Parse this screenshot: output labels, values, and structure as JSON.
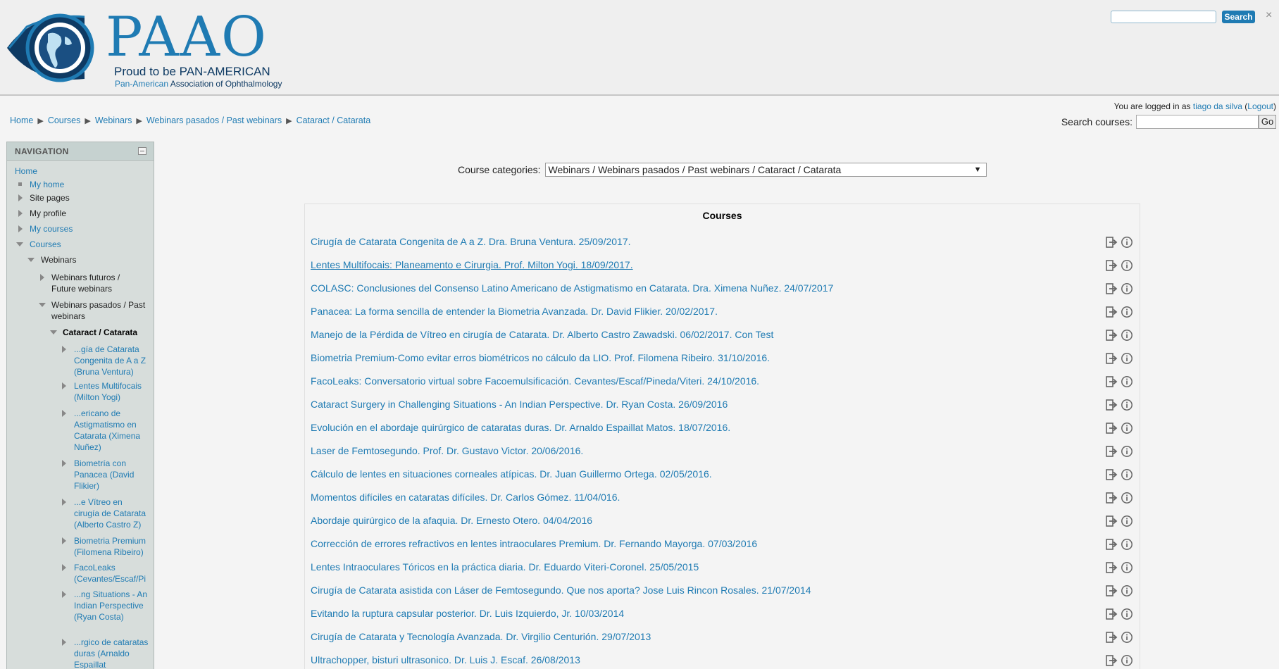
{
  "header": {
    "logo": {
      "wordmark": "PAAO",
      "tagline": "Proud to be PAN-AMERICAN",
      "subtitle_part1": "Pan-American",
      "subtitle_part2": "Association of Ophthalmology"
    },
    "search_placeholder": "",
    "search_button": "Search",
    "close_glyph": "×"
  },
  "login": {
    "prefix": "You are logged in as",
    "user": "tiago da silva",
    "logout": "Logout"
  },
  "breadcrumb": [
    "Home",
    "Courses",
    "Webinars",
    "Webinars pasados / Past webinars",
    "Cataract / Catarata"
  ],
  "course_search": {
    "label": "Search courses:",
    "placeholder": "",
    "go": "Go"
  },
  "navigation": {
    "title": "NAVIGATION",
    "home": "Home",
    "my_home": "My home",
    "site_pages": "Site pages",
    "my_profile": "My profile",
    "my_courses": "My courses",
    "courses": "Courses",
    "webinars": "Webinars",
    "future_webinars": "Webinars futuros / Future webinars",
    "past_webinars": "Webinars pasados / Past webinars",
    "cataract": "Cataract / Catarata",
    "items": [
      "...gía de Catarata Congenita de A a Z (Bruna Ventura)",
      "Lentes Multifocais (Milton Yogi)",
      "...ericano de Astigmatismo en Catarata (Ximena Nuñez)",
      "Biometría con Panacea (David Flikier)",
      "...e Vítreo en cirugía de Catarata (Alberto Castro Z)",
      "Biometria Premium (Filomena Ribeiro)",
      "FacoLeaks (Cevantes/Escaf/Pi",
      "...ng Situations - An Indian Perspective (Ryan Costa)",
      "...rgico de cataratas duras (Arnaldo Espaillat"
    ]
  },
  "category": {
    "label": "Course categories:",
    "selected": "Webinars / Webinars pasados / Past webinars / Cataract / Catarata"
  },
  "courses": {
    "title": "Courses",
    "list": [
      "Cirugía de Catarata Congenita de A a Z. Dra. Bruna Ventura. 25/09/2017.",
      "Lentes Multifocais: Planeamento e Cirurgia. Prof. Milton Yogi. 18/09/2017.",
      "COLASC: Conclusiones del Consenso Latino Americano de Astigmatismo en Catarata. Dra. Ximena Nuñez. 24/07/2017",
      "Panacea: La forma sencilla de entender la Biometria Avanzada. Dr. David Flikier. 20/02/2017.",
      "Manejo de la Pérdida de Vítreo en cirugía de Catarata. Dr. Alberto Castro Zawadski. 06/02/2017. Con Test",
      "Biometria Premium-Como evitar erros biométricos no cálculo da LIO. Prof. Filomena Ribeiro. 31/10/2016.",
      "FacoLeaks: Conversatorio virtual sobre Facoemulsificación. Cevantes/Escaf/Pineda/Viteri. 24/10/2016.",
      "Cataract Surgery in Challenging Situations - An Indian Perspective. Dr. Ryan Costa. 26/09/2016",
      "Evolución en el abordaje quirúrgico de cataratas duras. Dr. Arnaldo Espaillat Matos. 18/07/2016.",
      "Laser de Femtosegundo. Prof. Dr. Gustavo Victor. 20/06/2016.",
      "Cálculo de lentes en situaciones corneales atípicas. Dr. Juan Guillermo Ortega. 02/05/2016.",
      "Momentos difíciles en cataratas difíciles. Dr. Carlos Gómez. 11/04/016.",
      "Abordaje quirúrgico de la afaquia. Dr. Ernesto Otero. 04/04/2016",
      "Corrección de errores refractivos en lentes intraoculares Premium. Dr. Fernando Mayorga. 07/03/2016",
      "Lentes Intraoculares Tóricos en la práctica diaria. Dr. Eduardo Viteri-Coronel. 25/05/2015",
      "Cirugía de Catarata asistida con Láser de Femtosegundo. Que nos aporta? Jose Luis Rincon Rosales. 21/07/2014",
      "Evitando la ruptura capsular posterior. Dr. Luis Izquierdo, Jr. 10/03/2014",
      "Cirugía de Catarata y Tecnología Avanzada. Dr. Virgilio Centurión. 29/07/2013",
      "Ultrachopper, bisturi ultrasonico. Dr. Luis J. Escaf. 26/08/2013"
    ]
  },
  "colors": {
    "link": "#1f7bb3",
    "nav_bg": "#d7dddb",
    "logo_blue": "#1f7bb3",
    "header_bg": "#efefef"
  }
}
